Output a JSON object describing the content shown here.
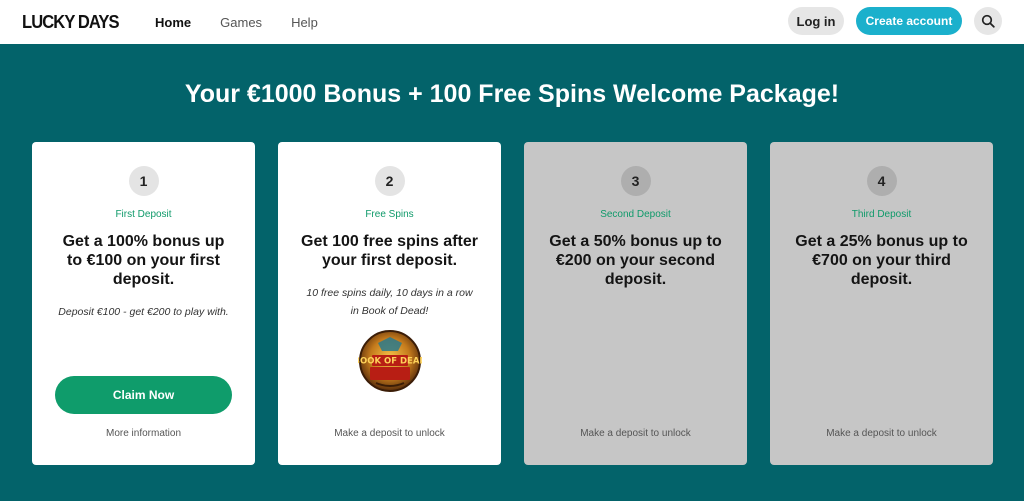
{
  "header": {
    "logo": "LUCKY DAYS",
    "nav": [
      "Home",
      "Games",
      "Help"
    ],
    "login_label": "Log in",
    "create_label": "Create account",
    "search_icon": "search-icon"
  },
  "main": {
    "headline": "Your €1000 Bonus + 100 Free Spins Welcome Package!",
    "cards": [
      {
        "number": "1",
        "step": "First Deposit",
        "title": "Get a 100% bonus up to €100 on your first deposit.",
        "desc": "Deposit €100 - get €200 to play with.",
        "button": "Claim Now",
        "footer": "More information"
      },
      {
        "number": "2",
        "step": "Free Spins",
        "title": "Get 100 free spins after your first deposit.",
        "desc": "10 free spins daily, 10 days in a row in Book of Dead!",
        "image_label": "BOOK OF DEAD",
        "footer": "Make a deposit to unlock"
      },
      {
        "number": "3",
        "step": "Second Deposit",
        "title": "Get a 50% bonus up to €200 on your second deposit.",
        "footer": "Make a deposit to unlock"
      },
      {
        "number": "4",
        "step": "Third Deposit",
        "title": "Get a 25% bonus up to €700 on your third deposit.",
        "footer": "Make a deposit to unlock"
      }
    ]
  },
  "colors": {
    "background": "#03636a",
    "accent_green": "#0f9c6b",
    "accent_blue": "#1bb0cc",
    "locked_card": "#c6c6c6"
  }
}
